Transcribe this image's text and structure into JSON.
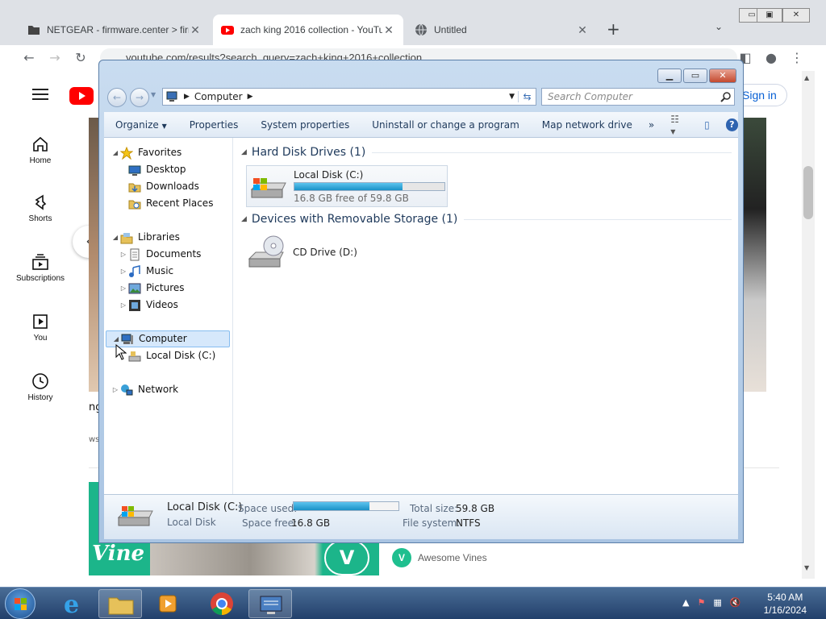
{
  "browser": {
    "tabs": [
      {
        "title": "NETGEAR - firmware.center > firm",
        "close": "✕"
      },
      {
        "title": "zach king 2016 collection - YouTu",
        "close": "✕"
      },
      {
        "title": "Untitled",
        "close": "✕"
      }
    ],
    "new_tab": "+",
    "url": "youtube.com/results?search_query=zach+king+2016+collection"
  },
  "youtube": {
    "logo_text": "YouTube",
    "sign_in": "Sign in",
    "sidebar": [
      {
        "label": "Home",
        "icon": "home-icon"
      },
      {
        "label": "Shorts",
        "icon": "shorts-icon"
      },
      {
        "label": "Subscriptions",
        "icon": "subscriptions-icon"
      },
      {
        "label": "You",
        "icon": "you-icon"
      },
      {
        "label": "History",
        "icon": "history-icon"
      }
    ],
    "partial_text_1": "ng",
    "partial_text_2": "ws",
    "channel_name": "Awesome Vines",
    "channel_avatar": "V",
    "vine_text": "Vine"
  },
  "explorer": {
    "address_crumb": "Computer",
    "search_placeholder": "Search Computer",
    "commands": [
      "Organize",
      "Properties",
      "System properties",
      "Uninstall or change a program",
      "Map network drive",
      "»"
    ],
    "nav": {
      "favorites": "Favorites",
      "desktop": "Desktop",
      "downloads": "Downloads",
      "recent": "Recent Places",
      "libraries": "Libraries",
      "documents": "Documents",
      "music": "Music",
      "pictures": "Pictures",
      "videos": "Videos",
      "computer": "Computer",
      "localdisk": "Local Disk (C:)",
      "network": "Network"
    },
    "groups": {
      "hdd": "Hard Disk Drives (1)",
      "removable": "Devices with Removable Storage (1)"
    },
    "drive_c": {
      "name": "Local Disk (C:)",
      "free": "16.8 GB free of 59.8 GB",
      "used_fraction": 0.72
    },
    "drive_d": {
      "name": "CD Drive (D:)"
    },
    "details": {
      "name": "Local Disk (C:)",
      "type": "Local Disk",
      "space_used_label": "Space used:",
      "space_free_label": "Space free:",
      "space_free": "16.8 GB",
      "total_label": "Total size:",
      "total": "59.8 GB",
      "fs_label": "File system:",
      "fs": "NTFS"
    }
  },
  "taskbar": {
    "time": "5:40 AM",
    "date": "1/16/2024"
  }
}
